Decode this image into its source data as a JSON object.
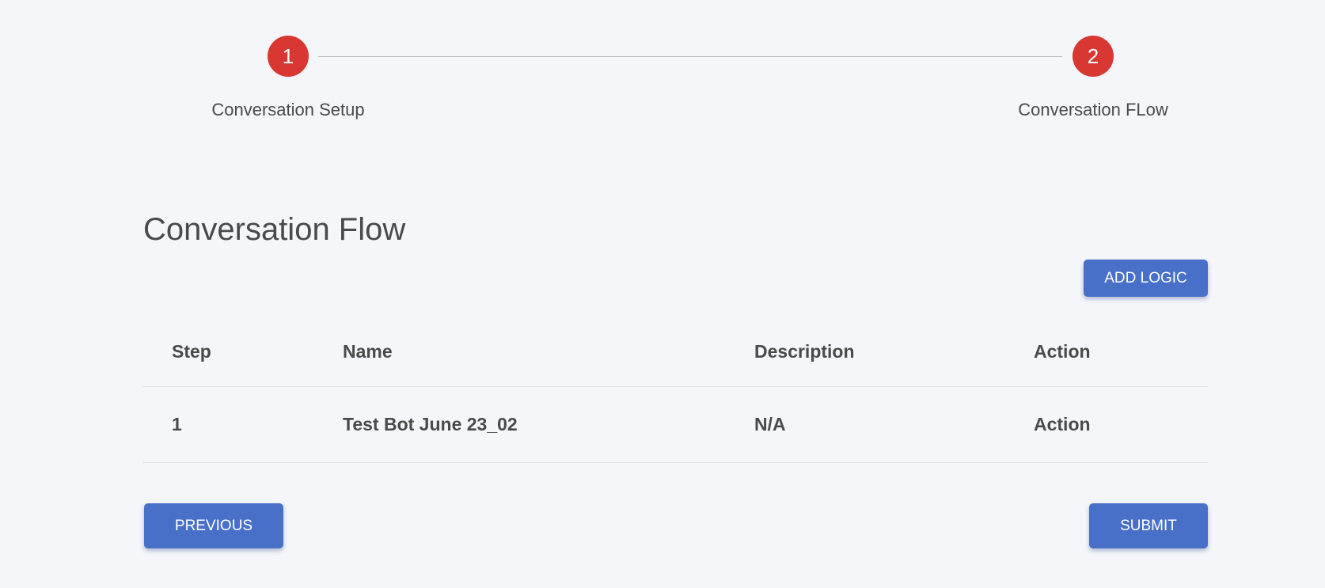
{
  "stepper": {
    "steps": [
      {
        "number": "1",
        "label": "Conversation Setup",
        "color": "#d93832"
      },
      {
        "number": "2",
        "label": "Conversation FLow",
        "color": "#d93832"
      }
    ]
  },
  "section": {
    "title": "Conversation Flow"
  },
  "toolbar": {
    "add_logic_label": "ADD LOGIC"
  },
  "table": {
    "columns": [
      "Step",
      "Name",
      "Description",
      "Action"
    ],
    "rows": [
      {
        "step": "1",
        "name": "Test Bot June 23_02",
        "description": "N/A",
        "action": "Action"
      }
    ]
  },
  "footer": {
    "previous_label": "PREVIOUS",
    "submit_label": "SUBMIT"
  },
  "colors": {
    "accent": "#4870c8",
    "step_active": "#d93832",
    "background": "#f4f6fa"
  }
}
